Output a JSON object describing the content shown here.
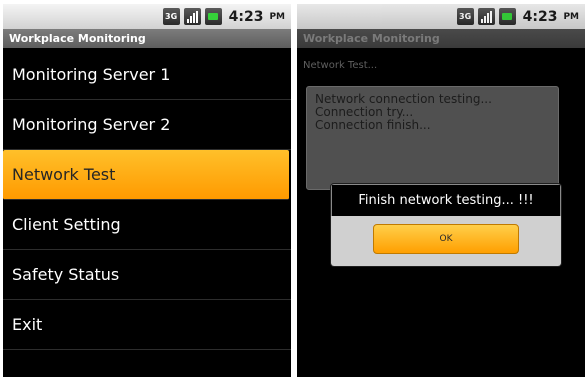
{
  "left_screen": {
    "status_bar": {
      "network_badge": "3G",
      "time": "4:23",
      "ampm": "PM",
      "icons": [
        "3g-icon",
        "signal-icon",
        "battery-icon"
      ]
    },
    "app_title": "Workplace Monitoring",
    "menu_items": [
      {
        "label": "Monitoring Server 1"
      },
      {
        "label": "Monitoring Server 2"
      },
      {
        "label": "Network Test"
      },
      {
        "label": "Client Setting"
      },
      {
        "label": "Safety Status"
      },
      {
        "label": "Exit"
      }
    ],
    "selected_index": 2,
    "accent_color": "#ffb000"
  },
  "right_screen": {
    "status_bar": {
      "network_badge": "3G",
      "time": "4:23",
      "ampm": "PM"
    },
    "app_title": "Workplace Monitoring",
    "subtitle": "Network Test...",
    "log_lines": [
      "Network connection testing...",
      "Connection try...",
      "Connection finish..."
    ],
    "dialog": {
      "message": "Finish network testing... !!!",
      "ok_label": "OK"
    }
  }
}
